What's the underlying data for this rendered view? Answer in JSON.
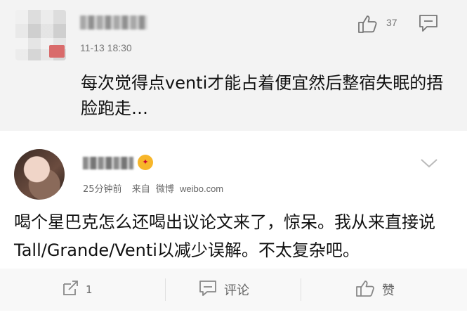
{
  "comment": {
    "time": "11-13 18:30",
    "like_count": "37",
    "text": "每次觉得点venti才能占着便宜然后整宿失眠的捂脸跑走…"
  },
  "post": {
    "time": "25分钟前",
    "source_prefix": "来自",
    "source": "微博",
    "domain": "weibo.com",
    "text": "喝个星巴克怎么还喝出议论文来了，惊呆。我从来直接说Tall/Grande/Venti以减少误解。不太复杂吧。",
    "repost_count": "1",
    "comment_label": "评论",
    "like_label": "赞"
  }
}
